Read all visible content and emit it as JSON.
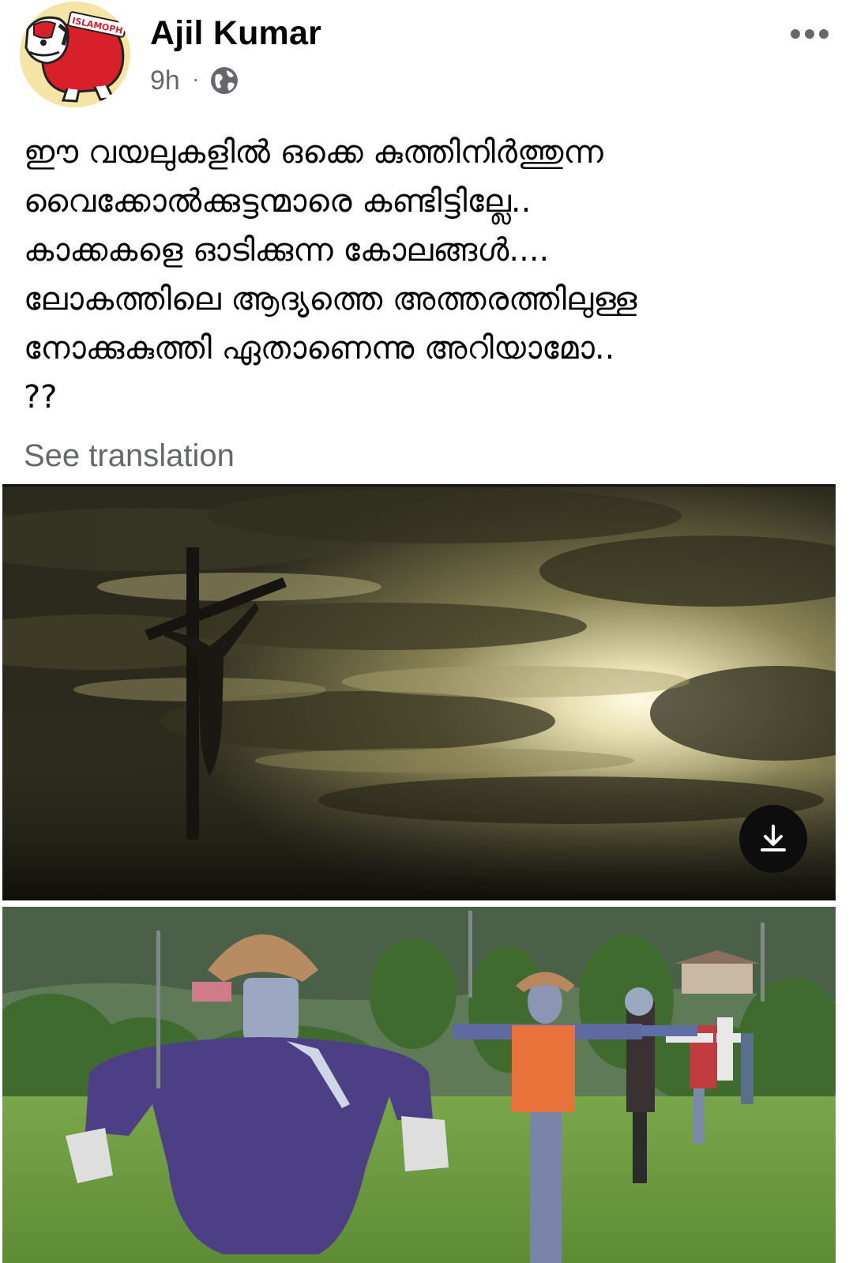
{
  "post": {
    "author_name": "Ajil Kumar",
    "timestamp": "9h",
    "separator": "·",
    "privacy_icon": "globe-icon",
    "menu_icon": "more-horizontal-icon",
    "avatar_logo_text": "ISLAMOPH",
    "body_lines": [
      "ഈ വയലുകളിൽ ഒക്കെ കുത്തിനിർത്തുന്ന",
      "വൈക്കോൽക്കുട്ടന്മാരെ കണ്ടിട്ടില്ലേ..",
      "കാക്കകളെ ഓടിക്കുന്ന കോലങ്ങൾ....",
      "ലോകത്തിലെ ആദ്യത്തെ അത്തരത്തിലുള്ള",
      "നോക്കുകുത്തി ഏതാണെന്നു അറിയാമോ..",
      "??"
    ],
    "see_translation": "See translation"
  },
  "media": {
    "photo_1_icon": "crucifix-silhouette-photo",
    "photo_2_icon": "scarecrows-field-photo",
    "download_icon": "download-icon"
  },
  "colors": {
    "secondary_text": "#65676b",
    "primary_text": "#050505",
    "avatar_red": "#d8202a"
  }
}
